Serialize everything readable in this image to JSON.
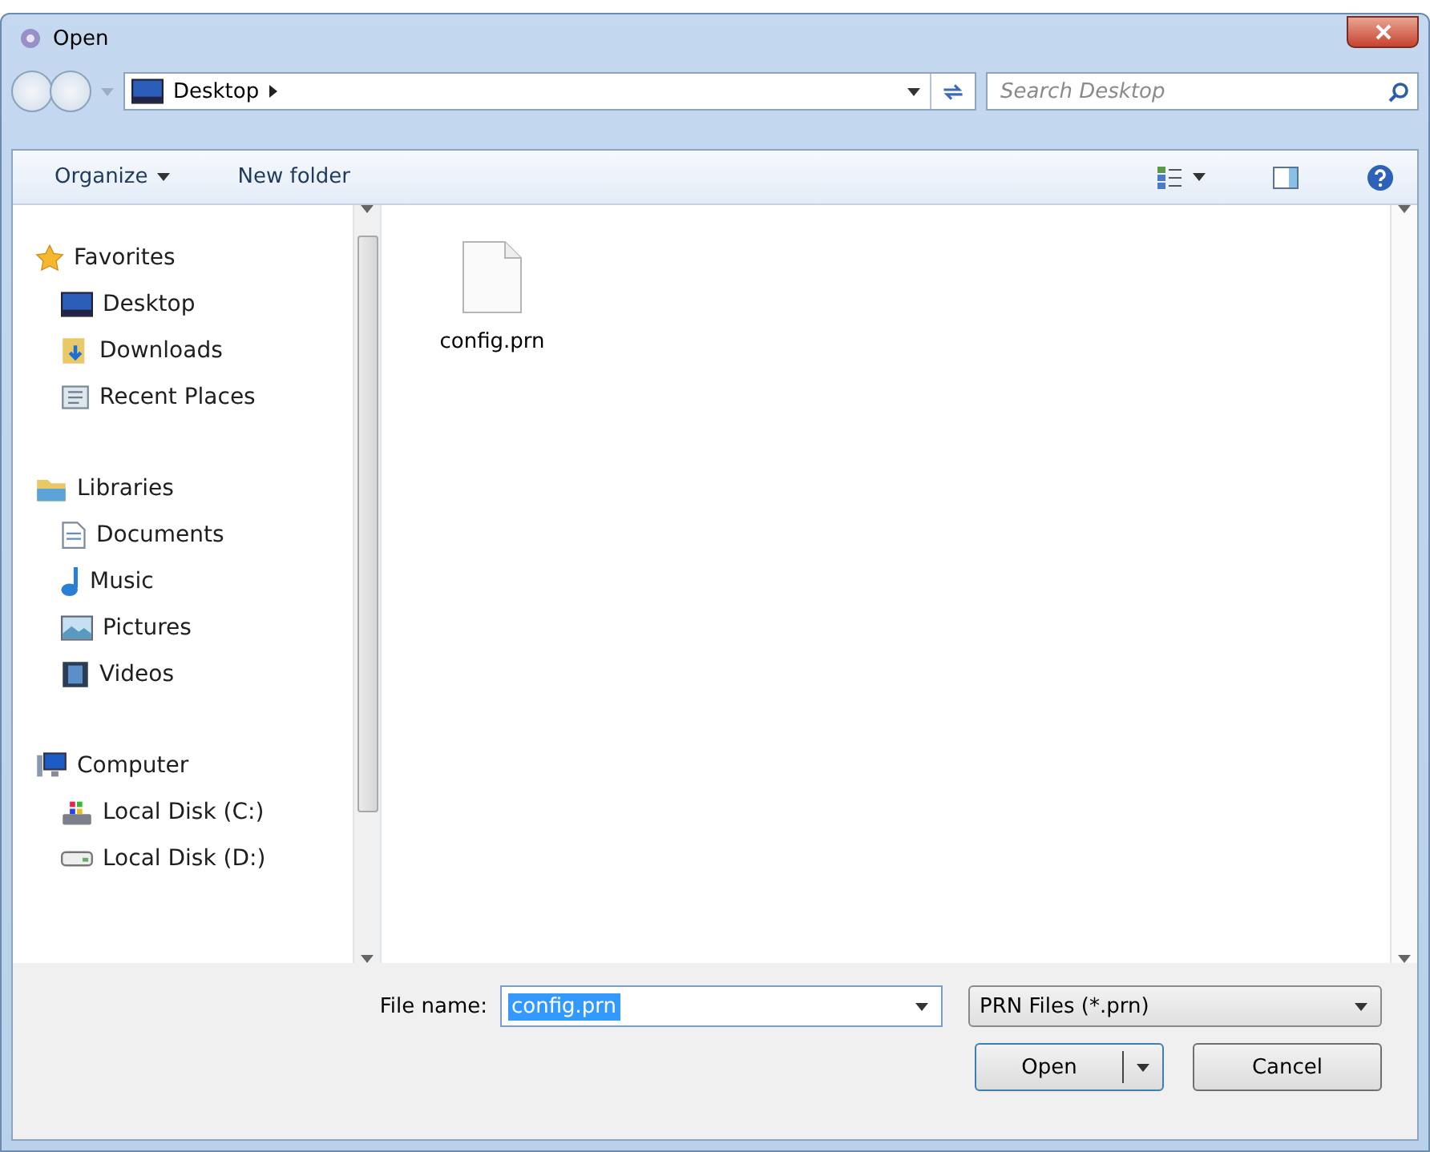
{
  "window": {
    "title": "Open"
  },
  "address": {
    "path": "Desktop",
    "search_placeholder": "Search Desktop"
  },
  "toolbar": {
    "buttons": [
      {
        "label": "Organize",
        "kind": "menu"
      },
      {
        "label": "New folder",
        "kind": "plain"
      }
    ]
  },
  "sidebar": {
    "groups": [
      {
        "label": "Favorites",
        "kind": "star",
        "children": [
          {
            "label": "Desktop",
            "kind": "desktop"
          },
          {
            "label": "Downloads",
            "kind": "downloads"
          },
          {
            "label": "Recent Places",
            "kind": "recent"
          }
        ]
      },
      {
        "label": "Libraries",
        "kind": "library",
        "children": [
          {
            "label": "Documents",
            "kind": "document"
          },
          {
            "label": "Music",
            "kind": "music"
          },
          {
            "label": "Pictures",
            "kind": "picture"
          },
          {
            "label": "Videos",
            "kind": "video"
          }
        ]
      },
      {
        "label": "Computer",
        "kind": "computer",
        "children": [
          {
            "label": "Local Disk (C:)",
            "kind": "systemdisk"
          },
          {
            "label": "Local Disk (D:)",
            "kind": "disk"
          }
        ]
      }
    ]
  },
  "files": [
    {
      "name": "config.prn"
    }
  ],
  "footer": {
    "file_name_label": "File name:",
    "file_name": "config.prn",
    "file_name_highlighted": true,
    "file_type": "PRN Files (*.prn)",
    "buttons": [
      {
        "label": "Open",
        "kind": "split"
      },
      {
        "label": "Cancel",
        "kind": "plain"
      }
    ]
  }
}
